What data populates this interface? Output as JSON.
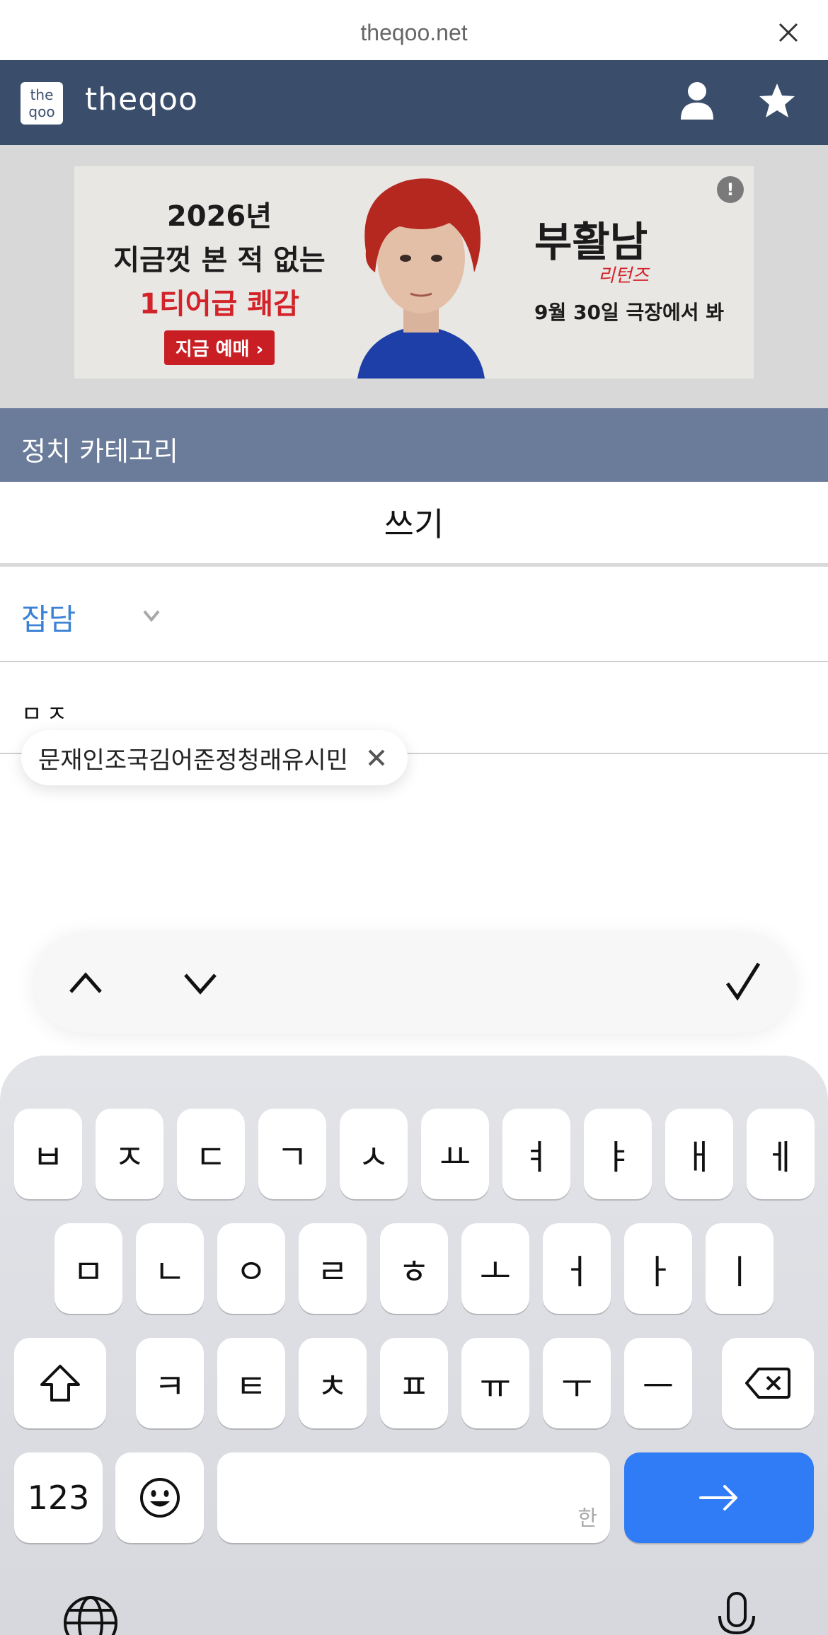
{
  "browser": {
    "url": "theqoo.net"
  },
  "header": {
    "site_name": "theqoo",
    "logo_text_top": "the",
    "logo_text_bottom": "qoo"
  },
  "ad": {
    "info_badge": "!",
    "year": "2026년",
    "line1": "지금껏 본 적 없는",
    "line2": "1티어급 쾌감",
    "cta": "지금 예매 ›",
    "title": "부활남",
    "subtitle": "리턴즈",
    "date": "9월 30일 극장에서 봐"
  },
  "category_bar": {
    "label": "정치 카테고리"
  },
  "page": {
    "heading": "쓰기"
  },
  "form": {
    "category_value": "잡담",
    "title_value": "ㅁㅈ",
    "autocomplete": "문재인조국김어준정청래유시민"
  },
  "keyboard": {
    "row1": [
      "ㅂ",
      "ㅈ",
      "ㄷ",
      "ㄱ",
      "ㅅ",
      "ㅛ",
      "ㅕ",
      "ㅑ",
      "ㅐ",
      "ㅔ"
    ],
    "row2": [
      "ㅁ",
      "ㄴ",
      "ㅇ",
      "ㄹ",
      "ㅎ",
      "ㅗ",
      "ㅓ",
      "ㅏ",
      "ㅣ"
    ],
    "row3": [
      "ㅋ",
      "ㅌ",
      "ㅊ",
      "ㅍ",
      "ㅠ",
      "ㅜ",
      "ㅡ"
    ],
    "numbers_key": "123",
    "space_hint": "한",
    "icons": {
      "shift": "shift-icon",
      "delete": "delete-icon",
      "emoji": "emoji-icon",
      "return": "arrow-right-icon",
      "globe": "globe-icon",
      "mic": "microphone-icon"
    },
    "return_color": "#2f7cf6"
  },
  "colors": {
    "header_bg": "#3a4e6c",
    "category_bg": "#6b7b9a",
    "select_text": "#3b82d6"
  }
}
